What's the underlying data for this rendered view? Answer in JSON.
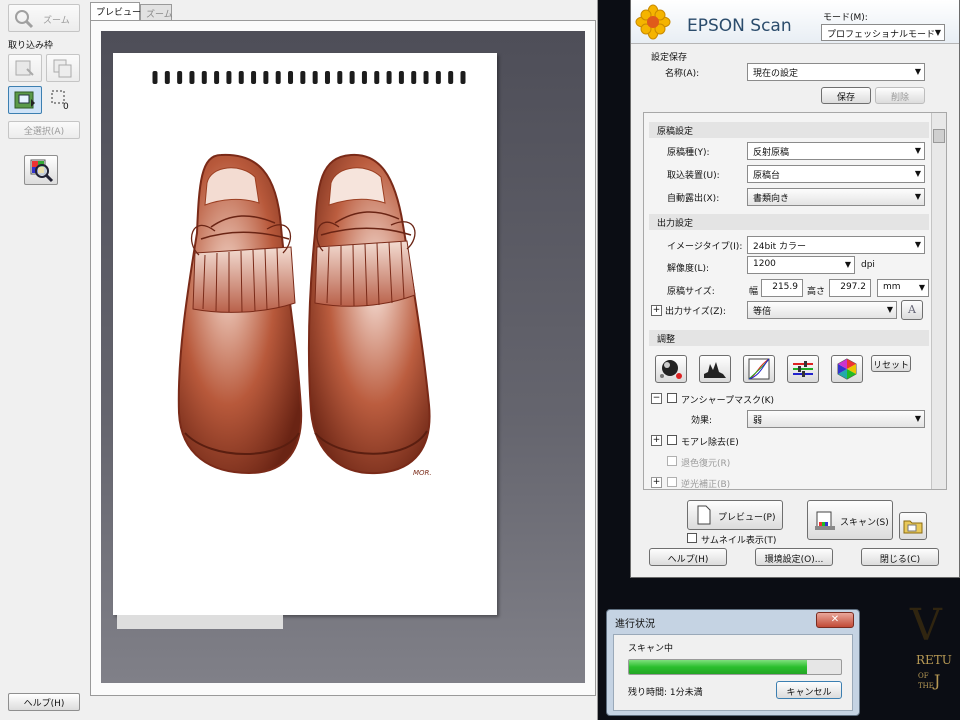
{
  "preview": {
    "zoom_button_label": "ズーム",
    "capture_frame_label": "取り込み枠",
    "frame_count": "0",
    "select_all_label": "全選択(A)",
    "help_label": "ヘルプ(H)",
    "tabs": [
      {
        "label": "プレビュー",
        "selected": true
      },
      {
        "label": "ズーム",
        "selected": false
      }
    ],
    "signature_text": "MOR."
  },
  "main": {
    "app_title": "EPSON Scan",
    "mode_label": "モード(M):",
    "mode_value": "プロフェッショナルモード",
    "settings_save": {
      "title": "設定保存",
      "name_label": "名称(A):",
      "name_value": "現在の設定",
      "save_label": "保存",
      "delete_label": "削除"
    },
    "document": {
      "title": "原稿設定",
      "doc_type_label": "原稿種(Y):",
      "doc_type_value": "反射原稿",
      "source_label": "取込装置(U):",
      "source_value": "原稿台",
      "auto_exposure_label": "自動露出(X):",
      "auto_exposure_value": "書類向き"
    },
    "output": {
      "title": "出力設定",
      "image_type_label": "イメージタイプ(I):",
      "image_type_value": "24bit カラー",
      "resolution_label": "解像度(L):",
      "resolution_value": "1200",
      "resolution_unit": "dpi",
      "size_label": "原稿サイズ:",
      "width_label": "幅",
      "width_value": "215.9",
      "height_label": "高さ",
      "height_value": "297.2",
      "unit_value": "mm",
      "output_size_label": "出力サイズ(Z):",
      "output_size_value": "等倍"
    },
    "adjust": {
      "title": "調整",
      "reset_label": "リセット",
      "unsharp_label": "アンシャープマスク(K)",
      "effect_label": "効果:",
      "effect_value": "弱",
      "moire_label": "モアレ除去(E)",
      "color_restore_label": "退色復元(R)",
      "backlight_label": "逆光補正(B)"
    },
    "buttons": {
      "preview_label": "プレビュー(P)",
      "scan_label": "スキャン(S)",
      "thumbnail_label": "サムネイル表示(T)",
      "help_label": "ヘルプ(H)",
      "config_label": "環境設定(O)...",
      "close_label": "閉じる(C)"
    }
  },
  "progress": {
    "title": "進行状況",
    "status": "スキャン中",
    "progress_fraction": 0.84,
    "remaining": "残り時間: 1分未満",
    "cancel_label": "キャンセル"
  },
  "colors": {
    "sketch_ink": "#9b3f22",
    "progress_green": "#2bbf2d",
    "close_red": "#c24a36"
  }
}
